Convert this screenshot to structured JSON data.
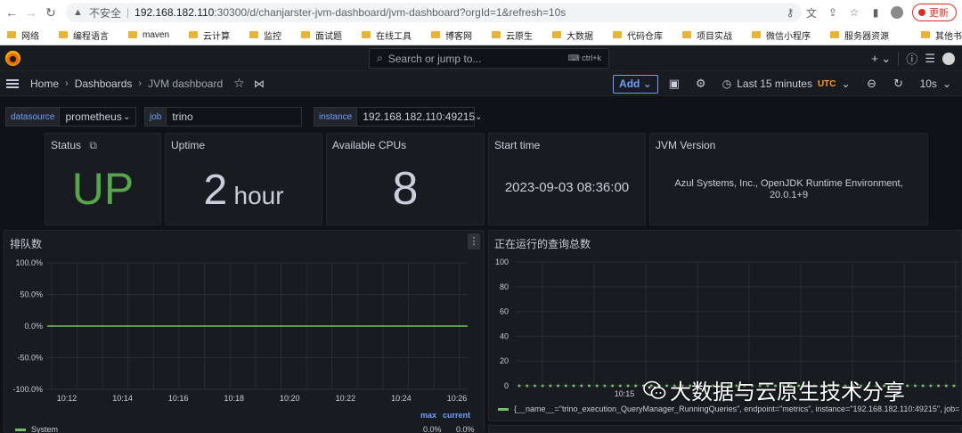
{
  "browser": {
    "insecure_label": "不安全",
    "url_host": "192.168.182.110",
    "url_path": ":30300/d/chanjarster-jvm-dashboard/jvm-dashboard?orgId=1&refresh=10s",
    "update_label": "更新",
    "bookmarks": [
      "网络",
      "编程语言",
      "maven",
      "云计算",
      "监控",
      "面试题",
      "在线工具",
      "博客网",
      "云原生",
      "大数据",
      "代码仓库",
      "项目实战",
      "微信小程序",
      "服务器资源"
    ],
    "other_bookmarks": "其他书"
  },
  "grafana": {
    "search_placeholder": "Search or jump to...",
    "search_shortcut": "ctrl+k",
    "breadcrumb": [
      "Home",
      "Dashboards",
      "JVM dashboard"
    ],
    "add_label": "Add",
    "time_range": "Last 15 minutes",
    "timezone": "UTC",
    "refresh": "10s"
  },
  "variables": [
    {
      "label": "datasource",
      "value": "prometheus",
      "dropdown": true
    },
    {
      "label": "job",
      "value": "trino",
      "dropdown": false
    },
    {
      "label": "instance",
      "value": "192.168.182.110:49215",
      "dropdown": true
    }
  ],
  "stats": {
    "status": {
      "title": "Status",
      "value": "UP",
      "color": "#56a64b"
    },
    "uptime": {
      "title": "Uptime",
      "value": "2",
      "unit": "hour"
    },
    "cpus": {
      "title": "Available CPUs",
      "value": "8"
    },
    "start_time": {
      "title": "Start time",
      "value": "2023-09-03 08:36:00"
    },
    "jvm_version": {
      "title": "JVM Version",
      "value": "Azul Systems, Inc., OpenJDK Runtime Environment, 20.0.1+9"
    }
  },
  "chart_data": [
    {
      "type": "line",
      "title": "排队数",
      "x": [
        "10:12",
        "10:14",
        "10:16",
        "10:18",
        "10:20",
        "10:22",
        "10:24",
        "10:26"
      ],
      "yticks": [
        "100.0%",
        "50.0%",
        "0.0%",
        "-50.0%",
        "-100.0%"
      ],
      "ylim": [
        -100,
        100
      ],
      "series": [
        {
          "name": "System",
          "values": [
            0,
            0,
            0,
            0,
            0,
            0,
            0,
            0
          ],
          "color": "#73bf69"
        }
      ],
      "legend_headers": [
        "max",
        "current"
      ],
      "legend_values": [
        "0.0%",
        "0.0%"
      ],
      "grid": true
    },
    {
      "type": "line",
      "title": "正在运行的查询总数",
      "x_visible_tick": "10:15",
      "yticks": [
        "100",
        "80",
        "60",
        "40",
        "20",
        "0"
      ],
      "ylim": [
        0,
        100
      ],
      "series": [
        {
          "name": "{__name__=\"trino_execution_QueryManager_RunningQueries\", endpoint=\"metrics\", instance=\"192.168.182.110:49215\", job=",
          "values": [
            0,
            0,
            0,
            0,
            0,
            0,
            0,
            0,
            0,
            0,
            0,
            0,
            0,
            0,
            0,
            0,
            0,
            0,
            0,
            0,
            0,
            0,
            0,
            0,
            0,
            0,
            0,
            0,
            0,
            0,
            0,
            0,
            0,
            0,
            0,
            0,
            0,
            0,
            0,
            0,
            0,
            0,
            0,
            0,
            0,
            0,
            0,
            0,
            0,
            0,
            0,
            0,
            0,
            0,
            0,
            0,
            0
          ],
          "color": "#73bf69"
        }
      ],
      "grid": true
    }
  ],
  "watermark": "大数据与云原生技术分享"
}
